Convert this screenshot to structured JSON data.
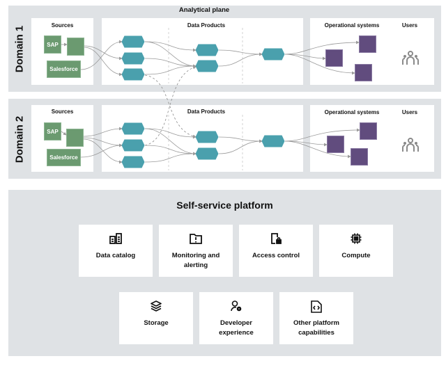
{
  "analytical_plane": {
    "title": "Analytical plane",
    "domains": [
      {
        "label": "Domain 1",
        "sources_title": "Sources",
        "sources": [
          "SAP",
          "Salesforce"
        ],
        "data_products_title": "Data Products",
        "operational_title": "Operational systems",
        "users_title": "Users"
      },
      {
        "label": "Domain 2",
        "sources_title": "Sources",
        "sources": [
          "SAP",
          "Salesforce"
        ],
        "data_products_title": "Data Products",
        "operational_title": "Operational systems",
        "users_title": "Users"
      }
    ]
  },
  "platform": {
    "title": "Self-service platform",
    "capabilities": [
      {
        "label": "Data catalog",
        "icon": "data-catalog-icon"
      },
      {
        "label": "Monitoring and alerting",
        "icon": "folder-alert-icon"
      },
      {
        "label": "Access control",
        "icon": "document-lock-icon"
      },
      {
        "label": "Compute",
        "icon": "chip-icon"
      },
      {
        "label": "Storage",
        "icon": "layers-icon"
      },
      {
        "label": "Developer experience",
        "icon": "user-gear-icon"
      },
      {
        "label": "Other platform capabilities",
        "icon": "code-file-icon"
      }
    ]
  },
  "colors": {
    "panel": "#dfe2e5",
    "source_green": "#6b9a70",
    "data_product_teal": "#4aa0ad",
    "operational_purple": "#614c7e",
    "connector_gray": "#9a9a9a",
    "users_icon": "#8a8a8a"
  }
}
